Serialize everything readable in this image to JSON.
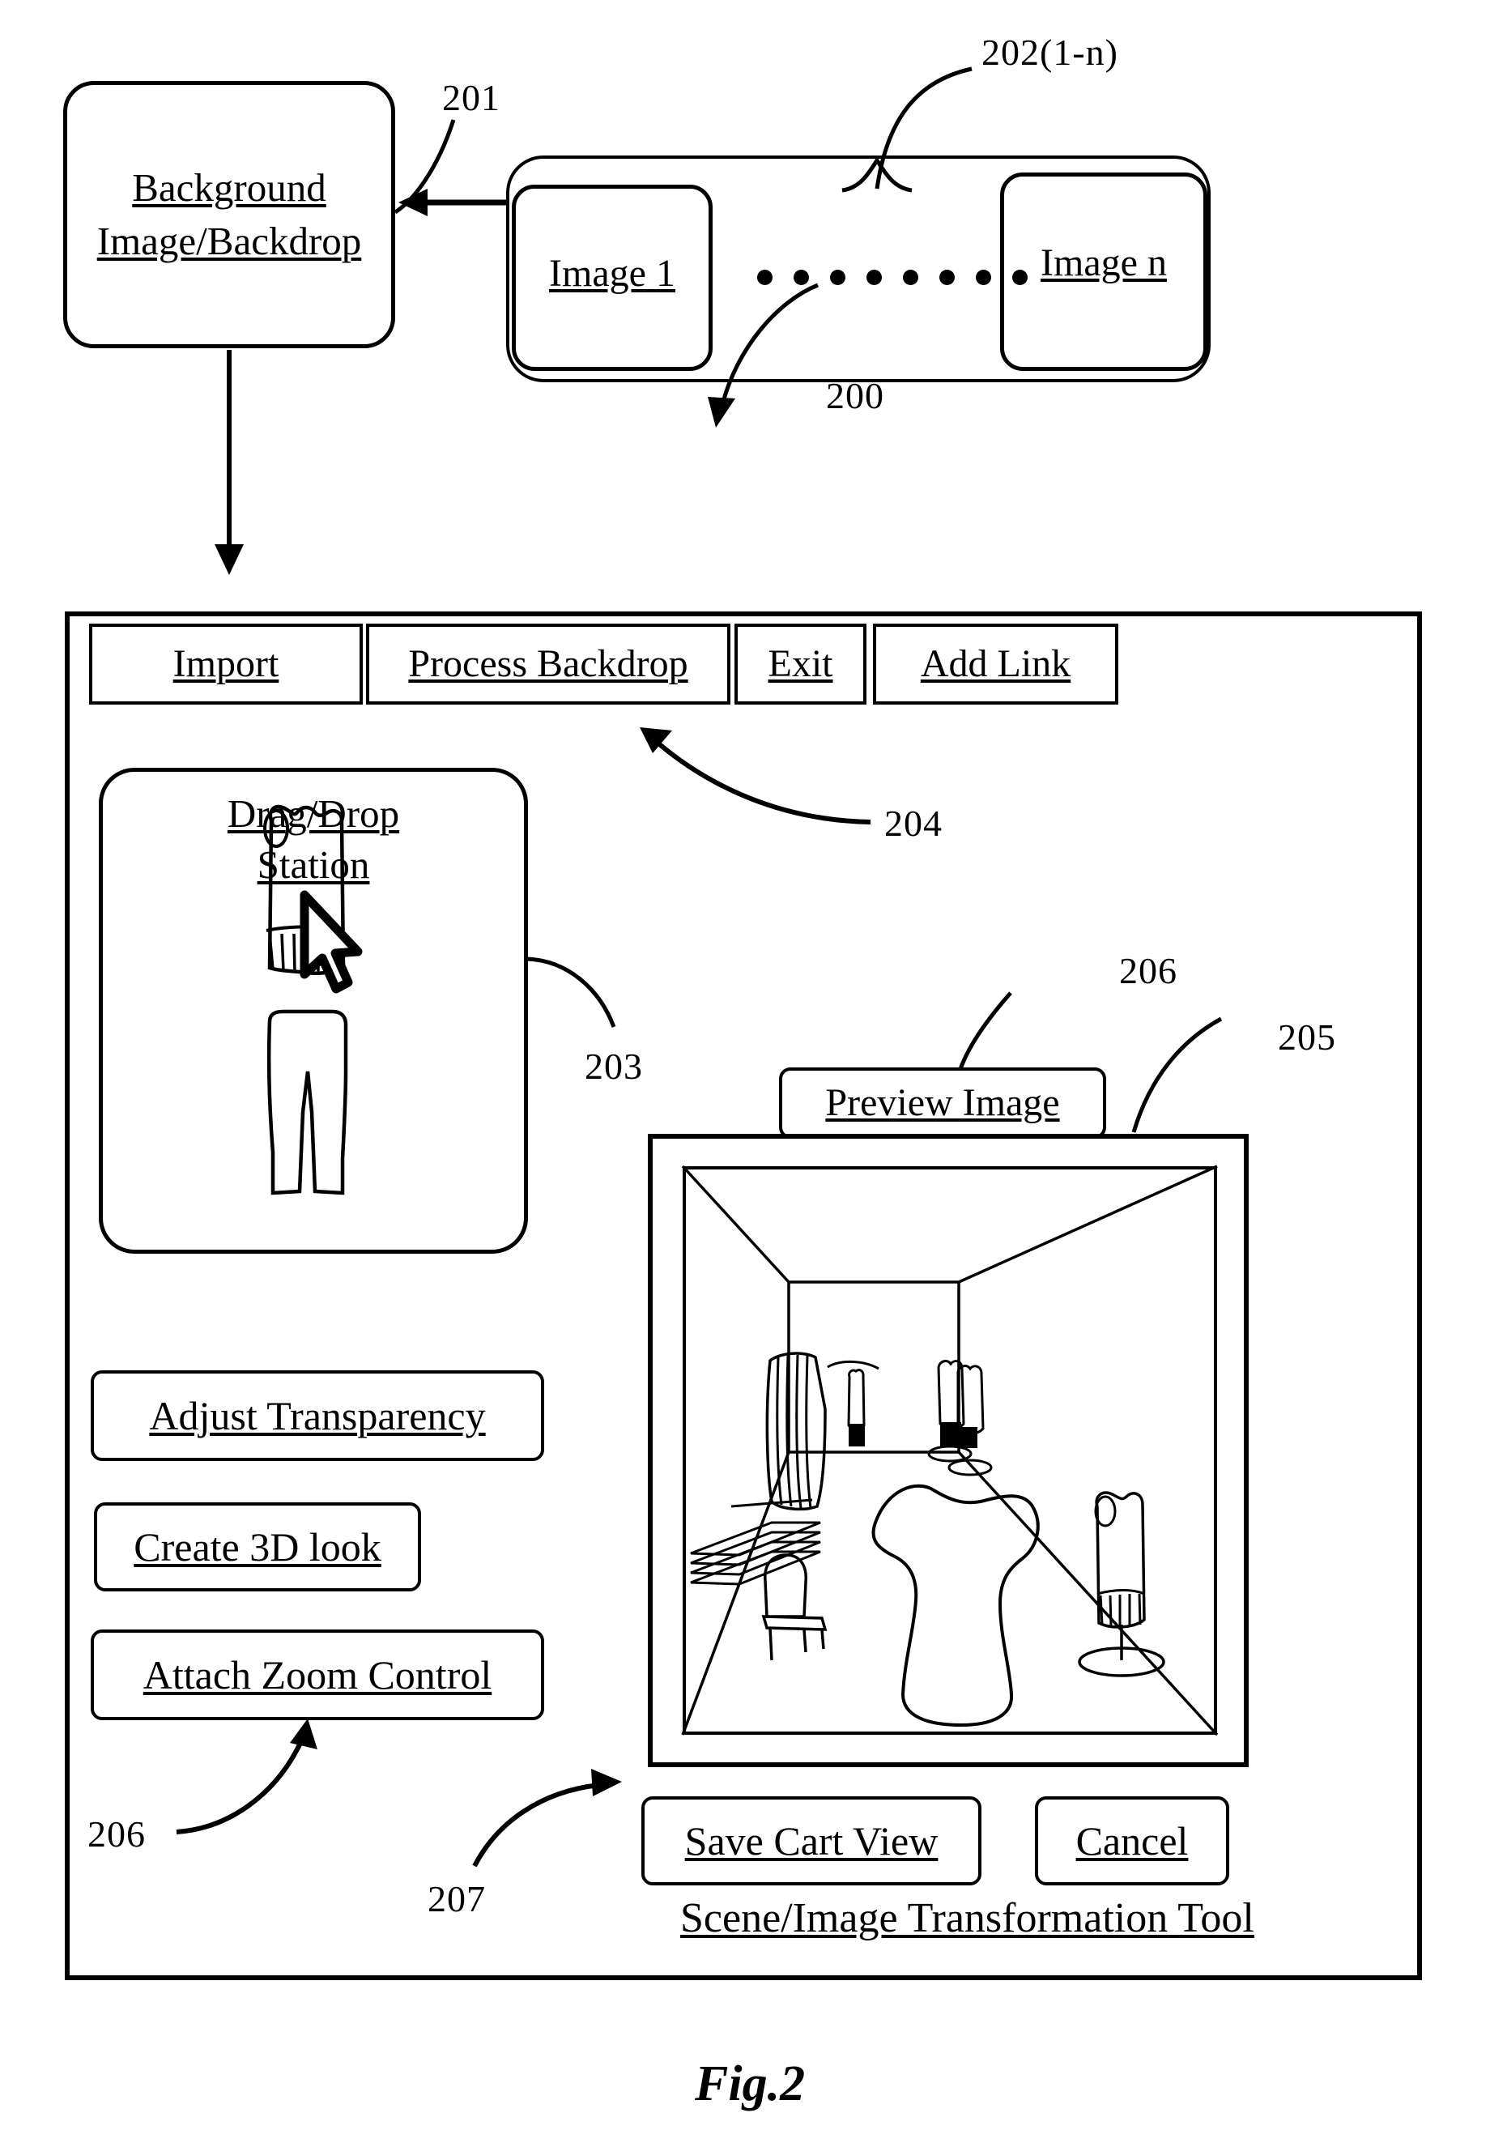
{
  "figure": {
    "caption": "Fig.2",
    "ref_numbers": {
      "system": "200",
      "backdrop": "201",
      "images_group": "202(1-n)",
      "garment_cursor": "203",
      "tool_window": "204",
      "preview_frame": "205",
      "preview_button": "206",
      "zoom_control_ref": "206",
      "save_cart_ref": "207"
    }
  },
  "backdrop_box": {
    "line1": "Background",
    "line2": "Image/Backdrop"
  },
  "image_group": {
    "first": "Image 1",
    "last": "Image n",
    "ellipsis_dot_count": 8
  },
  "tool_window": {
    "title": "Scene/Image Transformation Tool",
    "toolbar": [
      {
        "label": "Import",
        "name": "import-button"
      },
      {
        "label": "Process Backdrop",
        "name": "process-backdrop-button"
      },
      {
        "label": "Exit",
        "name": "exit-button"
      },
      {
        "label": "Add Link",
        "name": "add-link-button"
      }
    ],
    "drag_drop_station": {
      "line1": "Drag/Drop",
      "line2": "Station",
      "items": [
        "shirt-sketch",
        "pants-sketch"
      ],
      "cursor": "arrow-cursor"
    },
    "side_buttons": [
      {
        "label": "Adjust Transparency",
        "name": "adjust-transparency-button"
      },
      {
        "label": "Create 3D look",
        "name": "create-3d-look-button"
      },
      {
        "label": "Attach Zoom Control",
        "name": "attach-zoom-control-button"
      }
    ],
    "preview": {
      "button_label": "Preview Image",
      "scene_items": [
        "clothing-rack-left",
        "shelf-stack-left",
        "chair",
        "hanging-garment-back",
        "hanging-garment-right-back",
        "mannequin-torso-center",
        "garment-stand-right"
      ]
    },
    "footer_buttons": [
      {
        "label": "Save Cart View",
        "name": "save-cart-view-button"
      },
      {
        "label": "Cancel",
        "name": "cancel-button"
      }
    ]
  },
  "colors": {
    "ink": "#000000",
    "paper": "#ffffff"
  }
}
